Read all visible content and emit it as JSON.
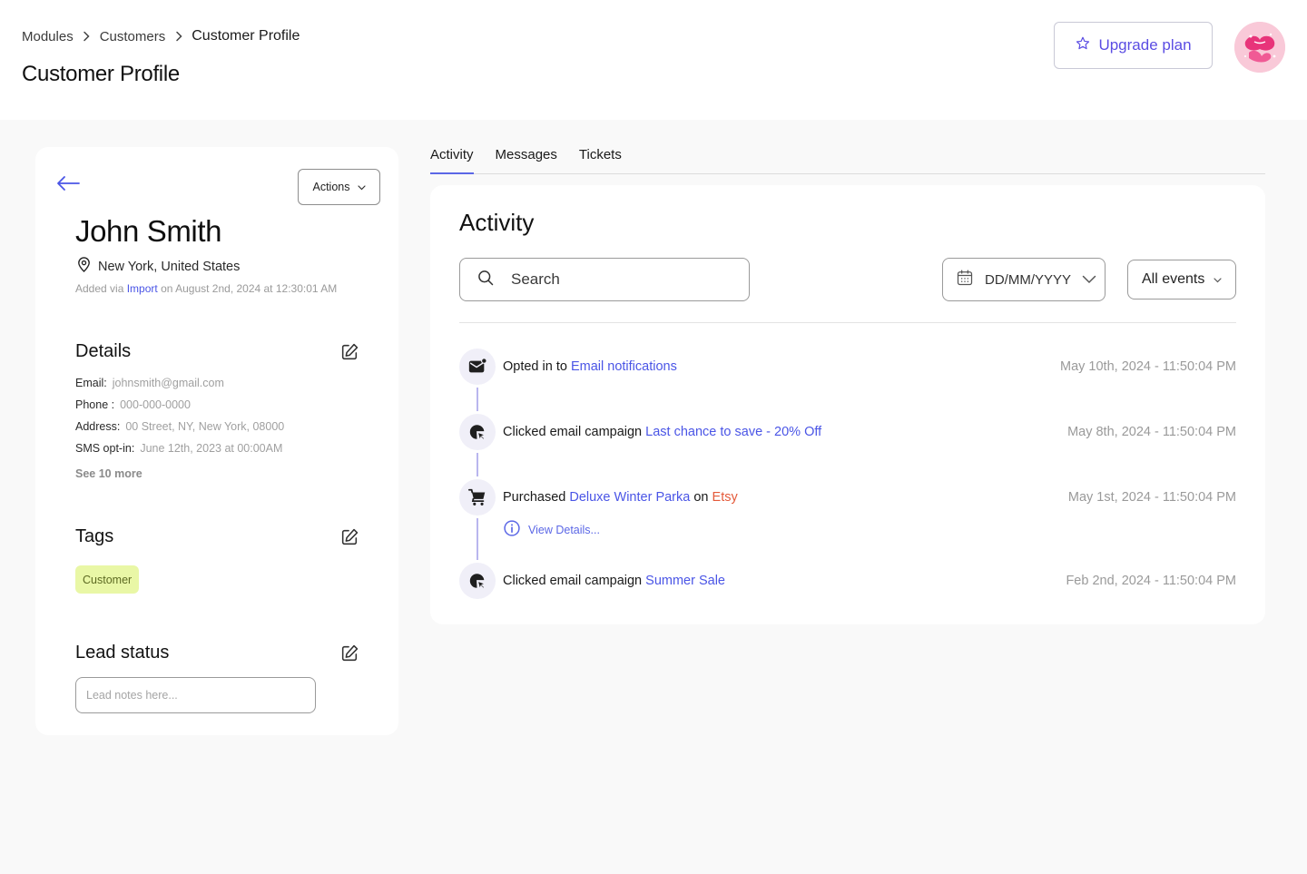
{
  "breadcrumb": {
    "items": [
      "Modules",
      "Customers",
      "Customer Profile"
    ]
  },
  "page_title": "Customer Profile",
  "header": {
    "upgrade_label": "Upgrade plan",
    "accent_color": "#5b4de3"
  },
  "customer": {
    "actions_label": "Actions",
    "name": "John Smith",
    "location": "New York, United States",
    "added_prefix": "Added via",
    "added_source": "Import",
    "added_suffix": "on August 2nd, 2024 at 12:30:01 AM"
  },
  "details": {
    "title": "Details",
    "rows": [
      {
        "label": "Email:",
        "value": "johnsmith@gmail.com"
      },
      {
        "label": "Phone :",
        "value": "000-000-0000"
      },
      {
        "label": "Address:",
        "value": "00 Street, NY, New York, 08000"
      },
      {
        "label": "SMS opt-in:",
        "value": "June 12th, 2023 at 00:00AM"
      }
    ],
    "see_more": "See 10 more"
  },
  "tags": {
    "title": "Tags",
    "items": [
      "Customer"
    ],
    "tag_color": "#e9f7a6"
  },
  "lead_status": {
    "title": "Lead status",
    "placeholder": "Lead notes here..."
  },
  "tabs": [
    {
      "label": "Activity",
      "active": true
    },
    {
      "label": "Messages",
      "active": false
    },
    {
      "label": "Tickets",
      "active": false
    }
  ],
  "activity": {
    "title": "Activity",
    "search_placeholder": "Search",
    "date_placeholder": "DD/MM/YYYY",
    "events_filter": "All events",
    "events": [
      {
        "icon": "mail-notification-icon",
        "text": "Opted in to",
        "link": "Email notifications",
        "timestamp": "May 10th, 2024 - 11:50:04 PM"
      },
      {
        "icon": "click-cursor-icon",
        "text": "Clicked email campaign",
        "link": "Last chance to save - 20% Off",
        "timestamp": "May 8th, 2024 - 11:50:04 PM"
      },
      {
        "icon": "shopping-cart-icon",
        "text": "Purchased",
        "link": "Deluxe Winter Parka",
        "connector": "on",
        "store": "Etsy",
        "timestamp": "May 1st, 2024 - 11:50:04 PM",
        "details_label": "View Details..."
      },
      {
        "icon": "click-cursor-icon",
        "text": "Clicked email campaign",
        "link": "Summer Sale",
        "timestamp": "Feb 2nd, 2024 - 11:50:04 PM"
      }
    ]
  }
}
